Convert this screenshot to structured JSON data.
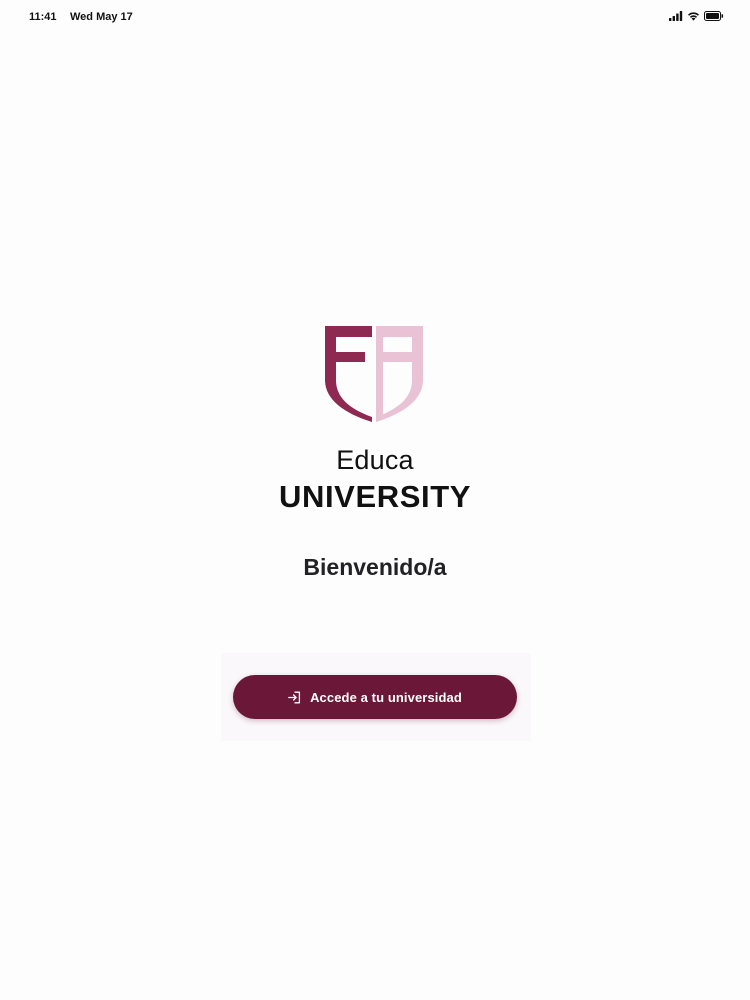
{
  "status_bar": {
    "time": "11:41",
    "date": "Wed May 17",
    "icons": [
      "signal-icon",
      "wifi-icon",
      "battery-icon"
    ]
  },
  "brand": {
    "logo_icon": "shield-logo-icon",
    "line1": "Educa",
    "line2": "UNIVERSITY",
    "colors": {
      "shield_dark": "#8e2a52",
      "shield_light": "#e9c3d5"
    }
  },
  "welcome": {
    "text": "Bienvenido/a"
  },
  "login": {
    "button_label": "Accede a tu universidad",
    "button_icon": "login-icon",
    "button_color": "#6a1738"
  }
}
